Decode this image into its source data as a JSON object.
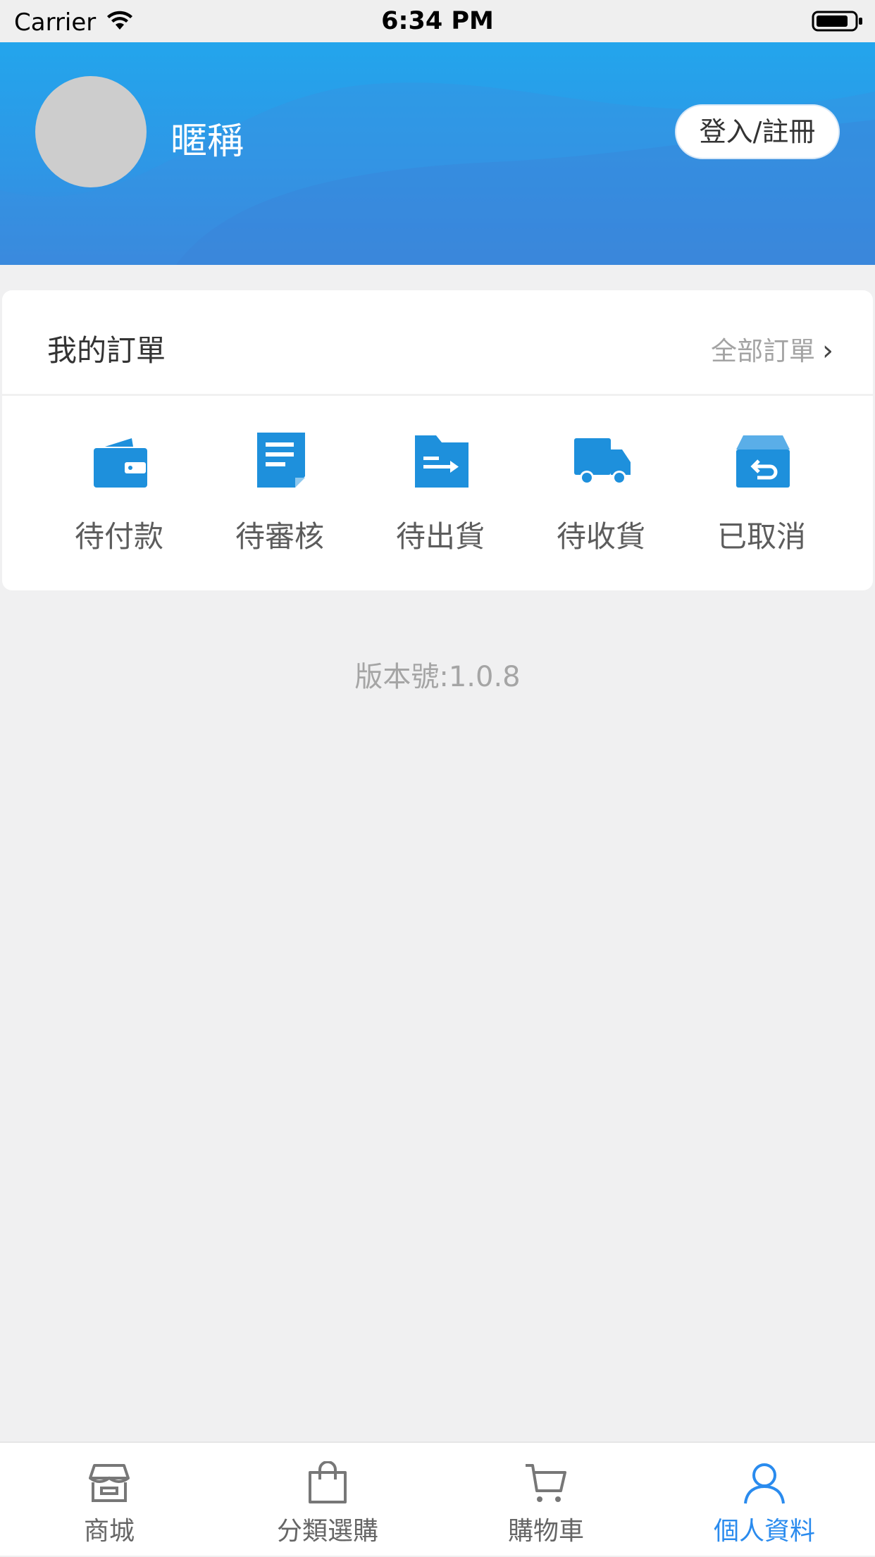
{
  "status_bar": {
    "carrier": "Carrier",
    "time": "6:34 PM"
  },
  "profile": {
    "nickname": "暱稱",
    "login_label": "登入/註冊"
  },
  "orders": {
    "title": "我的訂單",
    "all_label": "全部訂單",
    "items": [
      {
        "label": "待付款",
        "icon": "wallet-icon"
      },
      {
        "label": "待審核",
        "icon": "document-icon"
      },
      {
        "label": "待出貨",
        "icon": "folder-ship-icon"
      },
      {
        "label": "待收貨",
        "icon": "truck-icon"
      },
      {
        "label": "已取消",
        "icon": "return-box-icon"
      }
    ]
  },
  "version_text": "版本號:1.0.8",
  "tab_bar": {
    "items": [
      {
        "label": "商城",
        "icon": "store-icon"
      },
      {
        "label": "分類選購",
        "icon": "shopping-bag-icon"
      },
      {
        "label": "購物車",
        "icon": "cart-icon"
      },
      {
        "label": "個人資料",
        "icon": "user-icon",
        "active": true
      }
    ]
  },
  "colors": {
    "accent": "#2a8bee",
    "icon_blue": "#1e90dc",
    "header_top": "#23a5ec",
    "header_bottom": "#3a87dc"
  }
}
